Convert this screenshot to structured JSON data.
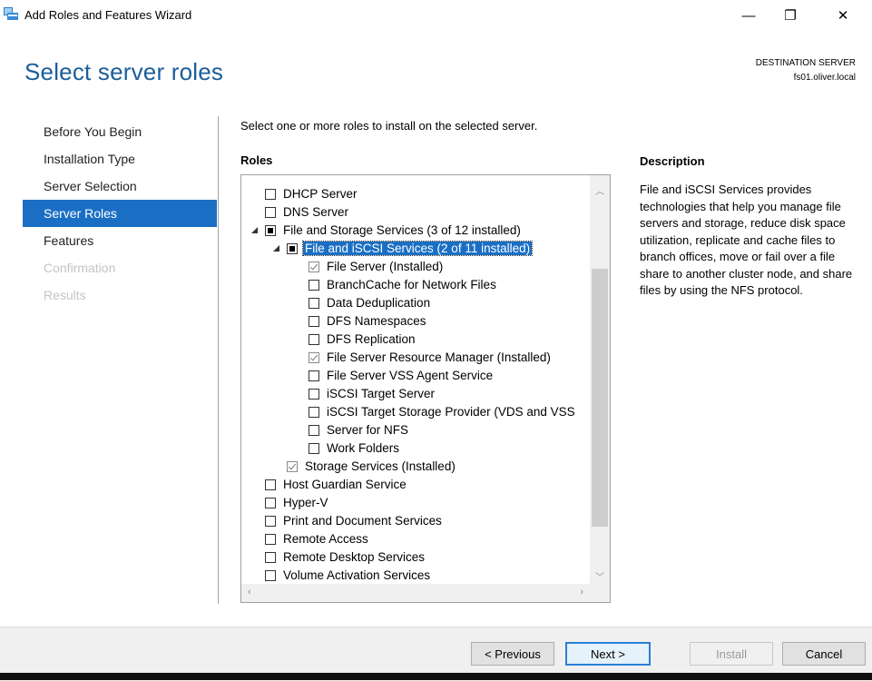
{
  "window": {
    "title": "Add Roles and Features Wizard",
    "controls": {
      "minimize": "—",
      "restore": "❐",
      "close": "✕"
    }
  },
  "header": {
    "title": "Select server roles",
    "destination_label": "DESTINATION SERVER",
    "destination_value": "fs01.oliver.local"
  },
  "nav": {
    "items": [
      {
        "label": "Before You Begin",
        "state": "normal"
      },
      {
        "label": "Installation Type",
        "state": "normal"
      },
      {
        "label": "Server Selection",
        "state": "normal"
      },
      {
        "label": "Server Roles",
        "state": "active"
      },
      {
        "label": "Features",
        "state": "normal"
      },
      {
        "label": "Confirmation",
        "state": "disabled"
      },
      {
        "label": "Results",
        "state": "disabled"
      }
    ]
  },
  "main": {
    "instruction": "Select one or more roles to install on the selected server.",
    "roles_heading": "Roles",
    "roles": [
      {
        "label": "DHCP Server",
        "level": 0,
        "state": "unchecked",
        "expander": "none"
      },
      {
        "label": "DNS Server",
        "level": 0,
        "state": "unchecked",
        "expander": "none"
      },
      {
        "label": "File and Storage Services (3 of 12 installed)",
        "level": 0,
        "state": "partial",
        "expander": "expanded"
      },
      {
        "label": "File and iSCSI Services (2 of 11 installed)",
        "level": 1,
        "state": "partial",
        "expander": "expanded",
        "selected": true
      },
      {
        "label": "File Server (Installed)",
        "level": 2,
        "state": "checked",
        "expander": "none"
      },
      {
        "label": "BranchCache for Network Files",
        "level": 2,
        "state": "unchecked",
        "expander": "none"
      },
      {
        "label": "Data Deduplication",
        "level": 2,
        "state": "unchecked",
        "expander": "none"
      },
      {
        "label": "DFS Namespaces",
        "level": 2,
        "state": "unchecked",
        "expander": "none"
      },
      {
        "label": "DFS Replication",
        "level": 2,
        "state": "unchecked",
        "expander": "none"
      },
      {
        "label": "File Server Resource Manager (Installed)",
        "level": 2,
        "state": "checked",
        "expander": "none"
      },
      {
        "label": "File Server VSS Agent Service",
        "level": 2,
        "state": "unchecked",
        "expander": "none"
      },
      {
        "label": "iSCSI Target Server",
        "level": 2,
        "state": "unchecked",
        "expander": "none"
      },
      {
        "label": "iSCSI Target Storage Provider (VDS and VSS",
        "level": 2,
        "state": "unchecked",
        "expander": "none"
      },
      {
        "label": "Server for NFS",
        "level": 2,
        "state": "unchecked",
        "expander": "none"
      },
      {
        "label": "Work Folders",
        "level": 2,
        "state": "unchecked",
        "expander": "none"
      },
      {
        "label": "Storage Services (Installed)",
        "level": 1,
        "state": "checked",
        "expander": "none"
      },
      {
        "label": "Host Guardian Service",
        "level": 0,
        "state": "unchecked",
        "expander": "none"
      },
      {
        "label": "Hyper-V",
        "level": 0,
        "state": "unchecked",
        "expander": "none"
      },
      {
        "label": "Print and Document Services",
        "level": 0,
        "state": "unchecked",
        "expander": "none"
      },
      {
        "label": "Remote Access",
        "level": 0,
        "state": "unchecked",
        "expander": "none"
      },
      {
        "label": "Remote Desktop Services",
        "level": 0,
        "state": "unchecked",
        "expander": "none"
      },
      {
        "label": "Volume Activation Services",
        "level": 0,
        "state": "unchecked",
        "expander": "none"
      }
    ],
    "description_heading": "Description",
    "description_text": "File and iSCSI Services provides technologies that help you manage file servers and storage, reduce disk space utilization, replicate and cache files to branch offices, move or fail over a file share to another cluster node, and share files by using the NFS protocol."
  },
  "footer": {
    "previous_label": "< Previous",
    "next_label": "Next >",
    "install_label": "Install",
    "cancel_label": "Cancel"
  },
  "colors": {
    "accent": "#1a6fc4",
    "title_blue": "#1a5e9a"
  }
}
